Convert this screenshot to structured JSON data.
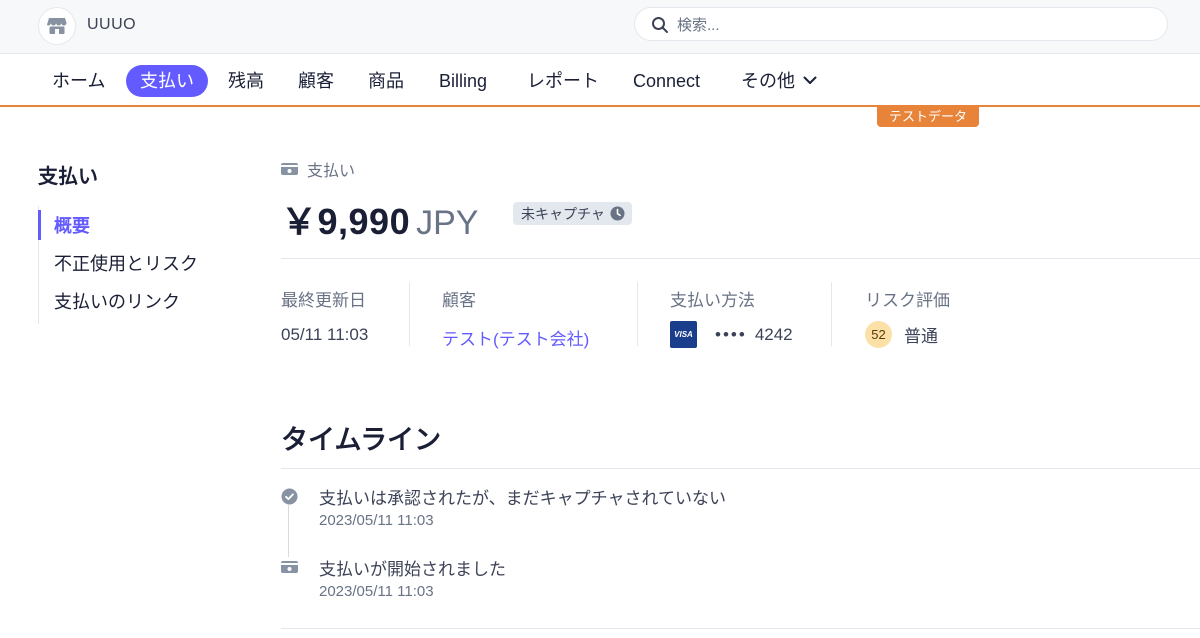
{
  "topbar": {
    "brand_name": "UUUO",
    "search_placeholder": "検索..."
  },
  "nav": {
    "items": [
      {
        "label": "ホーム"
      },
      {
        "label": "支払い",
        "active": true
      },
      {
        "label": "残高"
      },
      {
        "label": "顧客"
      },
      {
        "label": "商品"
      },
      {
        "label": "Billing"
      },
      {
        "label": "レポート"
      },
      {
        "label": "Connect"
      },
      {
        "label": "その他"
      }
    ],
    "test_badge": "テストデータ"
  },
  "sidebar": {
    "title": "支払い",
    "items": [
      {
        "label": "概要",
        "active": true
      },
      {
        "label": "不正使用とリスク"
      },
      {
        "label": "支払いのリンク"
      }
    ]
  },
  "payment": {
    "breadcrumb": "支払い",
    "amount": "￥9,990",
    "currency": "JPY",
    "status": "未キャプチャ"
  },
  "summary": {
    "updated": {
      "label": "最終更新日",
      "value": "05/11 11:03"
    },
    "customer": {
      "label": "顧客",
      "value": "テスト(テスト会社)"
    },
    "method": {
      "label": "支払い方法",
      "brand": "VISA",
      "dots": "••••",
      "last4": "4242"
    },
    "risk": {
      "label": "リスク評価",
      "score": "52",
      "level": "普通"
    }
  },
  "timeline": {
    "heading": "タイムライン",
    "events": [
      {
        "title": "支払いは承認されたが、まだキャプチャされていない",
        "time": "2023/05/11 11:03",
        "icon": "check-circle-icon"
      },
      {
        "title": "支払いが開始されました",
        "time": "2023/05/11 11:03",
        "icon": "payment-icon"
      }
    ]
  },
  "colors": {
    "accent": "#635bff",
    "test_mode": "#e8833a",
    "visa": "#1a3e8b",
    "risk_normal": "#fbe1a8"
  }
}
